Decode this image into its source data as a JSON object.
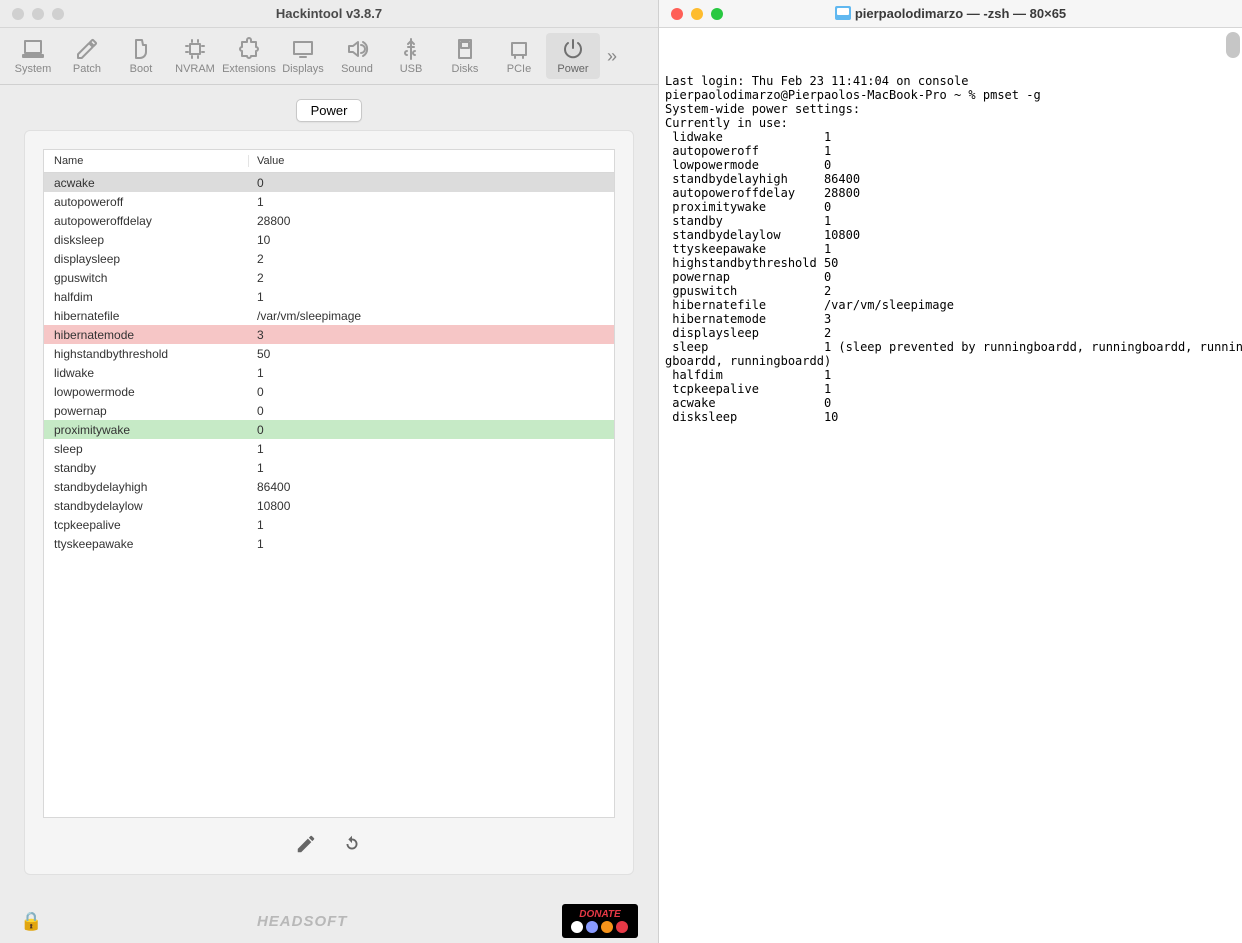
{
  "hackintool": {
    "title": "Hackintool v3.8.7",
    "toolbar": [
      {
        "id": "system",
        "label": "System",
        "icon": "monitor-icon"
      },
      {
        "id": "patch",
        "label": "Patch",
        "icon": "pencil-icon"
      },
      {
        "id": "boot",
        "label": "Boot",
        "icon": "boot-icon"
      },
      {
        "id": "nvram",
        "label": "NVRAM",
        "icon": "chip-icon"
      },
      {
        "id": "extensions",
        "label": "Extensions",
        "icon": "puzzle-icon"
      },
      {
        "id": "displays",
        "label": "Displays",
        "icon": "display-icon"
      },
      {
        "id": "sound",
        "label": "Sound",
        "icon": "speaker-icon"
      },
      {
        "id": "usb",
        "label": "USB",
        "icon": "usb-icon"
      },
      {
        "id": "disks",
        "label": "Disks",
        "icon": "disk-icon"
      },
      {
        "id": "pcie",
        "label": "PCIe",
        "icon": "pci-icon"
      },
      {
        "id": "power",
        "label": "Power",
        "icon": "power-icon",
        "active": true
      }
    ],
    "tab_label": "Power",
    "table": {
      "headers": {
        "name": "Name",
        "value": "Value"
      },
      "rows": [
        {
          "name": "acwake",
          "value": "0",
          "state": "selected"
        },
        {
          "name": "autopoweroff",
          "value": "1"
        },
        {
          "name": "autopoweroffdelay",
          "value": "28800"
        },
        {
          "name": "disksleep",
          "value": "10"
        },
        {
          "name": "displaysleep",
          "value": "2"
        },
        {
          "name": "gpuswitch",
          "value": "2"
        },
        {
          "name": "halfdim",
          "value": "1"
        },
        {
          "name": "hibernatefile",
          "value": "/var/vm/sleepimage"
        },
        {
          "name": "hibernatemode",
          "value": "3",
          "state": "red"
        },
        {
          "name": "highstandbythreshold",
          "value": "50"
        },
        {
          "name": "lidwake",
          "value": "1"
        },
        {
          "name": "lowpowermode",
          "value": "0"
        },
        {
          "name": "powernap",
          "value": "0"
        },
        {
          "name": "proximitywake",
          "value": "0",
          "state": "green"
        },
        {
          "name": "sleep",
          "value": "1"
        },
        {
          "name": "standby",
          "value": "1"
        },
        {
          "name": "standbydelayhigh",
          "value": "86400"
        },
        {
          "name": "standbydelaylow",
          "value": "10800"
        },
        {
          "name": "tcpkeepalive",
          "value": "1"
        },
        {
          "name": "ttyskeepawake",
          "value": "1"
        }
      ]
    },
    "footer_brand": "HEADSOFT",
    "donate_label": "DONATE"
  },
  "terminal": {
    "title": "pierpaolodimarzo — -zsh — 80×65",
    "lines": [
      "Last login: Thu Feb 23 11:41:04 on console",
      "pierpaolodimarzo@Pierpaolos-MacBook-Pro ~ % pmset -g",
      "System-wide power settings:",
      "Currently in use:",
      " lidwake              1",
      " autopoweroff         1",
      " lowpowermode         0",
      " standbydelayhigh     86400",
      " autopoweroffdelay    28800",
      " proximitywake        0",
      " standby              1",
      " standbydelaylow      10800",
      " ttyskeepawake        1",
      " highstandbythreshold 50",
      " powernap             0",
      " gpuswitch            2",
      " hibernatefile        /var/vm/sleepimage",
      " hibernatemode        3",
      " displaysleep         2",
      " sleep                1 (sleep prevented by runningboardd, runningboardd, runnin",
      "gboardd, runningboardd)",
      " halfdim              1",
      " tcpkeepalive         1",
      " acwake               0",
      " disksleep            10"
    ]
  }
}
